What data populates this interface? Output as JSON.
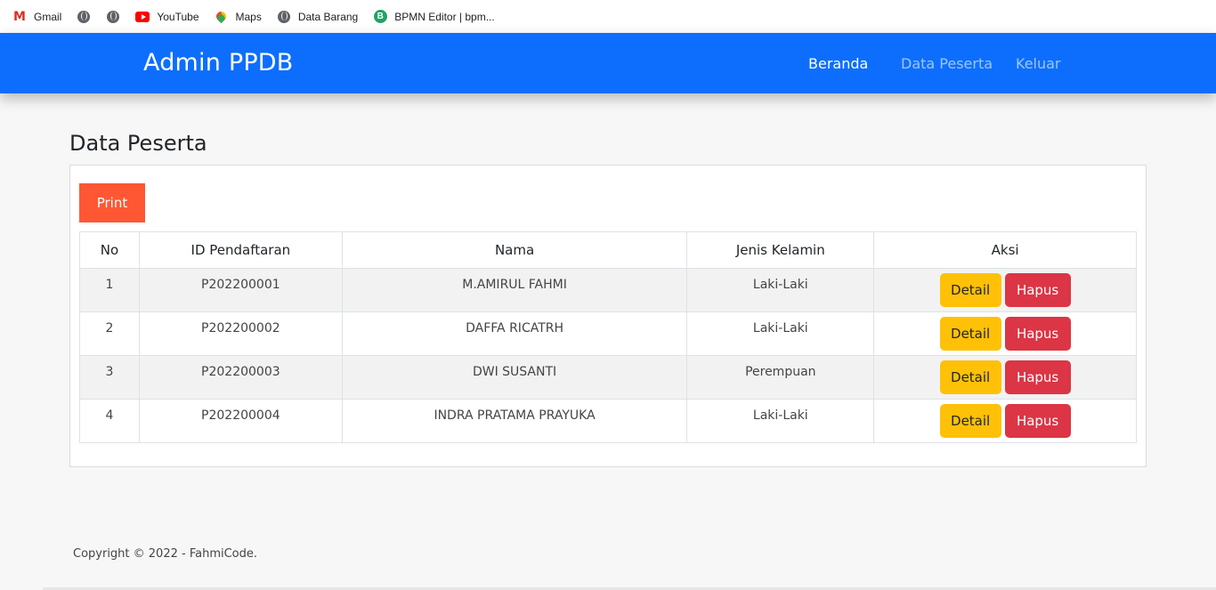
{
  "bookmarks": [
    {
      "label": "Gmail",
      "icon": "gmail-icon"
    },
    {
      "label": "",
      "icon": "globe-icon"
    },
    {
      "label": "",
      "icon": "globe-icon"
    },
    {
      "label": "YouTube",
      "icon": "youtube-icon"
    },
    {
      "label": "Maps",
      "icon": "maps-icon"
    },
    {
      "label": "Data Barang",
      "icon": "globe-icon"
    },
    {
      "label": "BPMN Editor | bpm...",
      "icon": "bpmn-icon"
    }
  ],
  "navbar": {
    "brand": "Admin PPDB",
    "links": [
      "Beranda",
      "Data Peserta",
      "Keluar"
    ],
    "color": "#0d6efd"
  },
  "main": {
    "title": "Data Peserta",
    "print_label": "Print",
    "table": {
      "headers": [
        "No",
        "ID Pendaftaran",
        "Nama",
        "Jenis Kelamin",
        "Aksi"
      ],
      "rows": [
        {
          "no": "1",
          "id": "P202200001",
          "nama": "M.AMIRUL FAHMI",
          "jk": "Laki-Laki"
        },
        {
          "no": "2",
          "id": "P202200002",
          "nama": "DAFFA RICATRH",
          "jk": "Laki-Laki"
        },
        {
          "no": "3",
          "id": "P202200003",
          "nama": "DWI SUSANTI",
          "jk": "Perempuan"
        },
        {
          "no": "4",
          "id": "P202200004",
          "nama": "INDRA PRATAMA PRAYUKA",
          "jk": "Laki-Laki"
        }
      ],
      "detail_label": "Detail",
      "hapus_label": "Hapus"
    }
  },
  "footer": {
    "text": "Copyright © 2022 - FahmiCode."
  },
  "colors": {
    "print": "#ff5733",
    "detail": "#ffc107",
    "hapus": "#dc3545"
  }
}
